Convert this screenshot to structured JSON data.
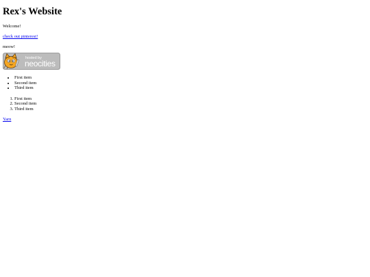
{
  "page": {
    "title": "Rex's Website",
    "welcome": "Welcome!",
    "pinterest_link": "check out pinterest!",
    "meow": "meow!",
    "badge": {
      "icon": "neocities-cat-icon",
      "text_top": "hosted by",
      "text_main": "neocities"
    },
    "unordered_list": [
      "First item",
      "Second item",
      "Third item"
    ],
    "ordered_list": [
      "First item",
      "Second item",
      "Third item"
    ],
    "yarn_link": "Yarn"
  },
  "colors": {
    "link": "#0000ee",
    "badge_bg": "#bcbcbc"
  }
}
